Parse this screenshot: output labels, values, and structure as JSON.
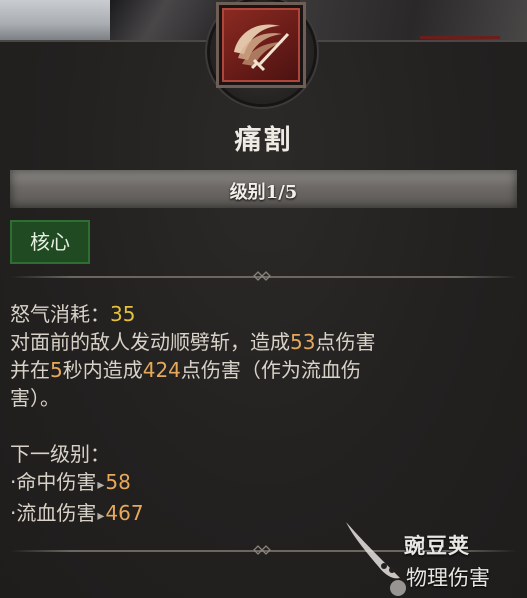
{
  "skill": {
    "name": "痛割",
    "rank": "级别1/5",
    "tag": "核心"
  },
  "description": {
    "cost_label": "怒气消耗：",
    "cost_value": "35",
    "line1_a": "对面前的敌人发动顺劈斩，造成",
    "line1_dmg": "53",
    "line1_b": "点伤害",
    "line2_a": "并在",
    "line2_sec": "5",
    "line2_b": "秒内造成",
    "line2_dot": "424",
    "line2_c": "点伤害（作为流血伤",
    "line3": "害）。"
  },
  "next_rank": {
    "header": "下一级别：",
    "items": [
      {
        "bullet": "·",
        "label": "命中伤害",
        "arrow": "▸",
        "value": "58"
      },
      {
        "bullet": "·",
        "label": "流血伤害",
        "arrow": "▸",
        "value": "467"
      }
    ]
  },
  "watermark": {
    "brand": "豌豆荚",
    "caption": "物理伤害"
  },
  "colors": {
    "panel_bg": "#232120",
    "value_yellow": "#e3c23a",
    "value_orange": "#e6a85a",
    "tag_green": "#1f4a22",
    "emblem_red": "#8a2a22"
  }
}
